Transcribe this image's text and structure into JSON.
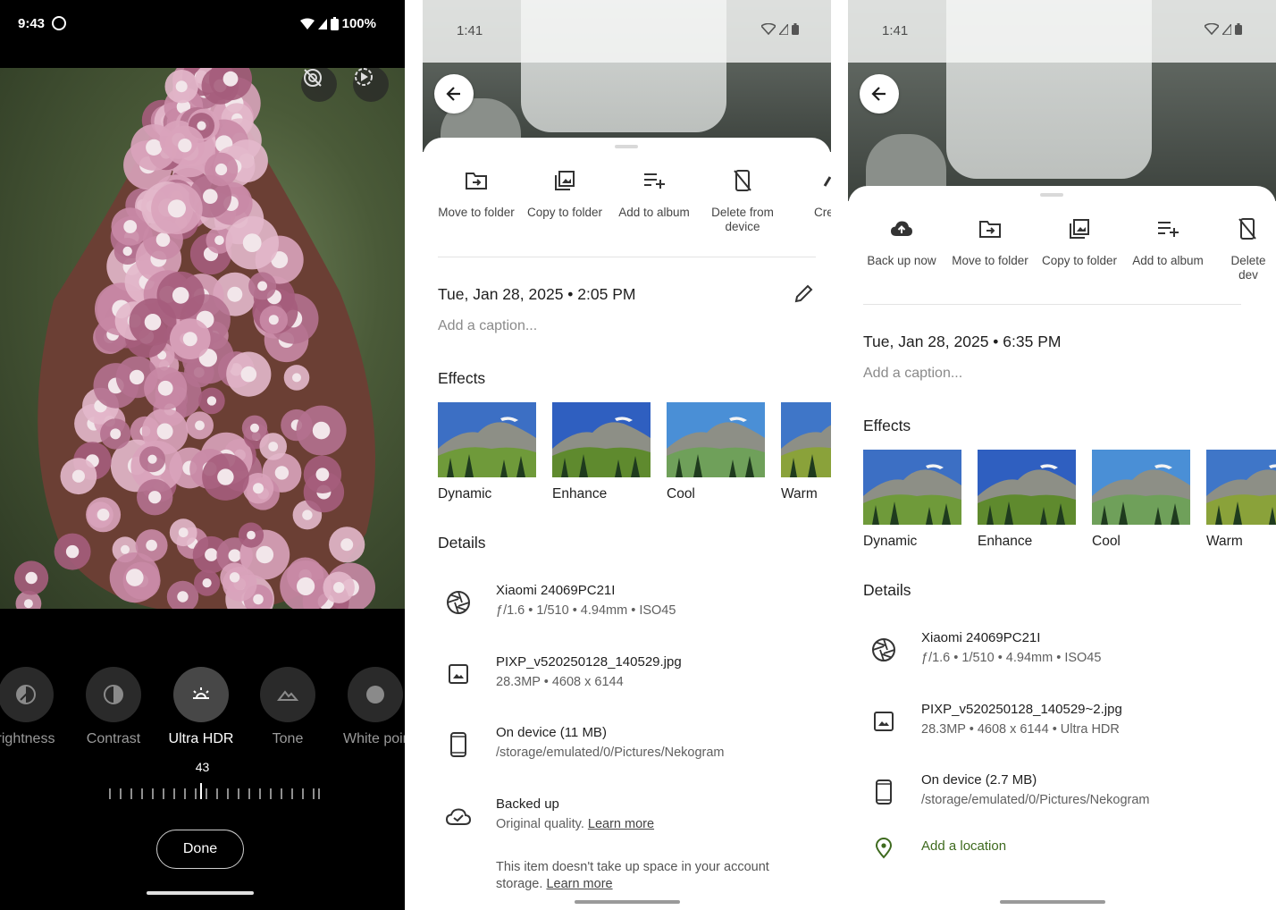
{
  "editor": {
    "status": {
      "time": "9:43",
      "battery": "100%"
    },
    "tools": [
      {
        "label": "rightness",
        "icon": "brightness-icon"
      },
      {
        "label": "Contrast",
        "icon": "contrast-icon"
      },
      {
        "label": "Ultra HDR",
        "icon": "ultra-hdr-icon"
      },
      {
        "label": "Tone",
        "icon": "tone-icon"
      },
      {
        "label": "White poir",
        "icon": "white-point-icon"
      }
    ],
    "slider_value": "43",
    "done_label": "Done"
  },
  "info_a": {
    "status": {
      "time": "1:41"
    },
    "actions": [
      {
        "label": "Move to folder",
        "icon": "move-to-folder-icon"
      },
      {
        "label": "Copy to folder",
        "icon": "copy-to-folder-icon"
      },
      {
        "label": "Add to album",
        "icon": "add-to-album-icon"
      },
      {
        "label": "Delete from device",
        "icon": "delete-from-device-icon"
      },
      {
        "label": "Cre",
        "icon": "create-icon"
      }
    ],
    "date": "Tue, Jan 28, 2025  •  2:05 PM",
    "caption_placeholder": "Add a caption...",
    "effects_title": "Effects",
    "effects": [
      "Dynamic",
      "Enhance",
      "Cool",
      "Warm"
    ],
    "details_title": "Details",
    "camera": {
      "model": "Xiaomi 24069PC21I",
      "specs": "ƒ/1.6  •  1/510  •  4.94mm  •  ISO45"
    },
    "file": {
      "name": "PIXP_v520250128_140529.jpg",
      "specs": "28.3MP  •  4608 x 6144"
    },
    "location": {
      "title": "On device (11 MB)",
      "path": "/storage/emulated/0/Pictures/Nekogram"
    },
    "backup": {
      "title": "Backed up",
      "text": "Original quality.",
      "link": "Learn more"
    },
    "note": {
      "line1": "This item doesn't take up space in your account",
      "line2": "storage.",
      "link": "Learn more"
    }
  },
  "info_b": {
    "status": {
      "time": "1:41"
    },
    "actions": [
      {
        "label": "Back up now",
        "icon": "backup-icon"
      },
      {
        "label": "Move to folder",
        "icon": "move-to-folder-icon"
      },
      {
        "label": "Copy to folder",
        "icon": "copy-to-folder-icon"
      },
      {
        "label": "Add to album",
        "icon": "add-to-album-icon"
      },
      {
        "label": "Delete dev",
        "icon": "delete-from-device-icon"
      }
    ],
    "date": "Tue, Jan 28, 2025  •  6:35 PM",
    "caption_placeholder": "Add a caption...",
    "effects_title": "Effects",
    "effects": [
      "Dynamic",
      "Enhance",
      "Cool",
      "Warm"
    ],
    "details_title": "Details",
    "camera": {
      "model": "Xiaomi 24069PC21I",
      "specs": "ƒ/1.6  •  1/510  •  4.94mm  •  ISO45"
    },
    "file": {
      "name": "PIXP_v520250128_140529~2.jpg",
      "specs": "28.3MP  •  4608 x 6144  •  Ultra HDR"
    },
    "location": {
      "title": "On device (2.7 MB)",
      "path": "/storage/emulated/0/Pictures/Nekogram"
    },
    "add_location": "Add a location"
  },
  "colors": {
    "accent_green": "#3e6a1e",
    "text_primary": "#1f1f1f",
    "text_secondary": "#5f5f5f"
  }
}
